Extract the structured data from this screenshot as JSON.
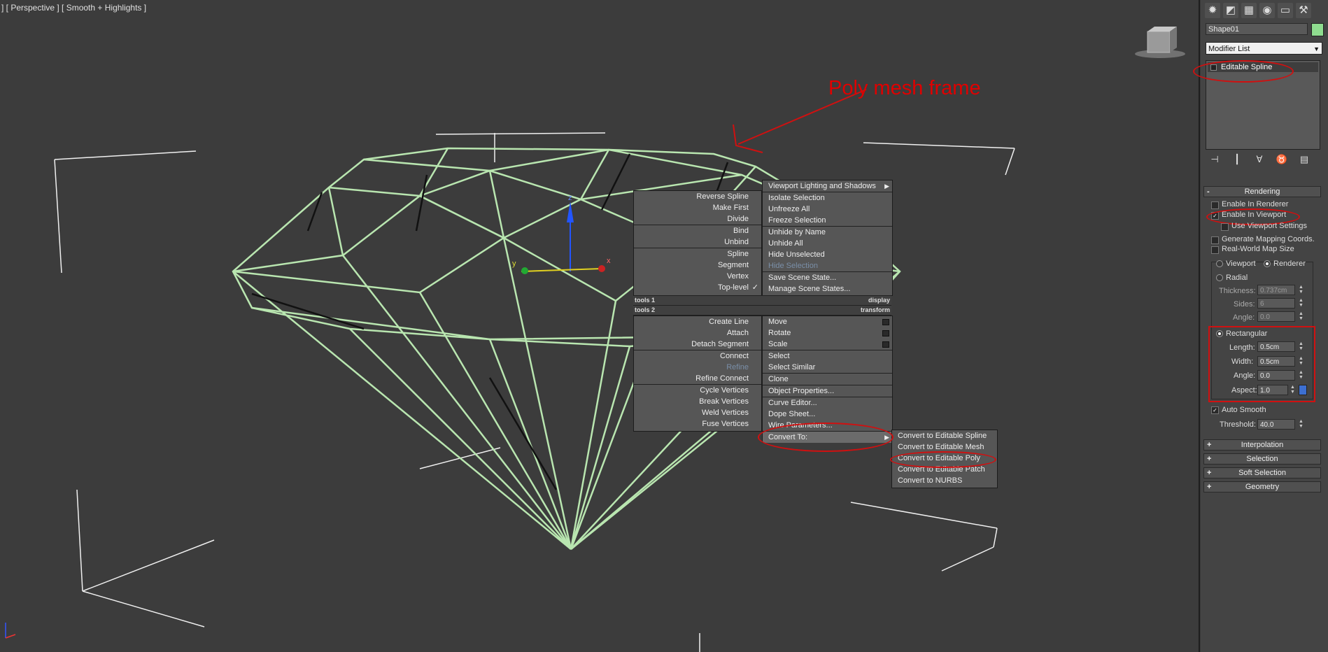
{
  "viewport": {
    "label": "] [ Perspective ] [ Smooth + Highlights ]",
    "annotation": "Poly mesh frame"
  },
  "quad_menu": {
    "left_items": [
      {
        "label": "Reverse Spline"
      },
      {
        "label": "Make First"
      },
      {
        "label": "Divide"
      },
      {
        "label": "Bind"
      },
      {
        "label": "Unbind"
      },
      {
        "label": "Spline"
      },
      {
        "label": "Segment"
      },
      {
        "label": "Vertex"
      },
      {
        "label": "Top-level",
        "checked": "✓"
      }
    ],
    "right_items": [
      {
        "label": "Viewport Lighting and Shadows"
      },
      {
        "label": "Isolate Selection"
      },
      {
        "label": "Unfreeze All"
      },
      {
        "label": "Freeze Selection"
      },
      {
        "label": "Unhide by Name"
      },
      {
        "label": "Unhide All"
      },
      {
        "label": "Hide Unselected"
      },
      {
        "label": "Hide Selection"
      },
      {
        "label": "Save Scene State..."
      },
      {
        "label": "Manage Scene States..."
      }
    ],
    "headers": [
      {
        "left": "tools 1",
        "right": "display"
      },
      {
        "left": "tools 2",
        "right": "transform"
      }
    ],
    "left_bottom": [
      {
        "label": "Create Line"
      },
      {
        "label": "Attach"
      },
      {
        "label": "Detach Segment"
      },
      {
        "label": "Connect"
      },
      {
        "label": "Refine"
      },
      {
        "label": "Refine Connect"
      },
      {
        "label": "Cycle Vertices"
      },
      {
        "label": "Break Vertices"
      },
      {
        "label": "Weld Vertices"
      },
      {
        "label": "Fuse Vertices"
      }
    ],
    "right_bottom": [
      {
        "label": "Move"
      },
      {
        "label": "Rotate"
      },
      {
        "label": "Scale"
      },
      {
        "label": "Select"
      },
      {
        "label": "Select Similar"
      },
      {
        "label": "Clone"
      },
      {
        "label": "Object Properties..."
      },
      {
        "label": "Curve Editor..."
      },
      {
        "label": "Dope Sheet..."
      },
      {
        "label": "Wire Parameters..."
      },
      {
        "label": "Convert To:"
      }
    ],
    "submenu": [
      {
        "label": "Convert to Editable Spline"
      },
      {
        "label": "Convert to Editable Mesh"
      },
      {
        "label": "Convert to Editable Poly"
      },
      {
        "label": "Convert to Editable Patch"
      },
      {
        "label": "Convert to NURBS"
      }
    ]
  },
  "panel": {
    "object_name": "Shape01",
    "modifier_list": "Modifier List",
    "stack_item": "Editable Spline",
    "rendering": {
      "title": "Rendering",
      "enable_renderer": "Enable In Renderer",
      "enable_viewport": "Enable In Viewport",
      "use_viewport_settings": "Use Viewport Settings",
      "generate_mapping": "Generate Mapping Coords.",
      "real_world": "Real-World Map Size",
      "viewport": "Viewport",
      "renderer": "Renderer",
      "radial": "Radial",
      "thickness_label": "Thickness:",
      "thickness": "0.737cm",
      "sides_label": "Sides:",
      "sides": "6",
      "angle_label": "Angle:",
      "angle": "0.0",
      "rectangular": "Rectangular",
      "length_label": "Length:",
      "length": "0.5cm",
      "width_label": "Width:",
      "width": "0.5cm",
      "angle2_label": "Angle:",
      "angle2": "0.0",
      "aspect_label": "Aspect:",
      "aspect": "1.0",
      "auto_smooth": "Auto Smooth",
      "threshold_label": "Threshold:",
      "threshold": "40.0"
    },
    "rollouts": [
      "Interpolation",
      "Selection",
      "Soft Selection",
      "Geometry"
    ]
  }
}
